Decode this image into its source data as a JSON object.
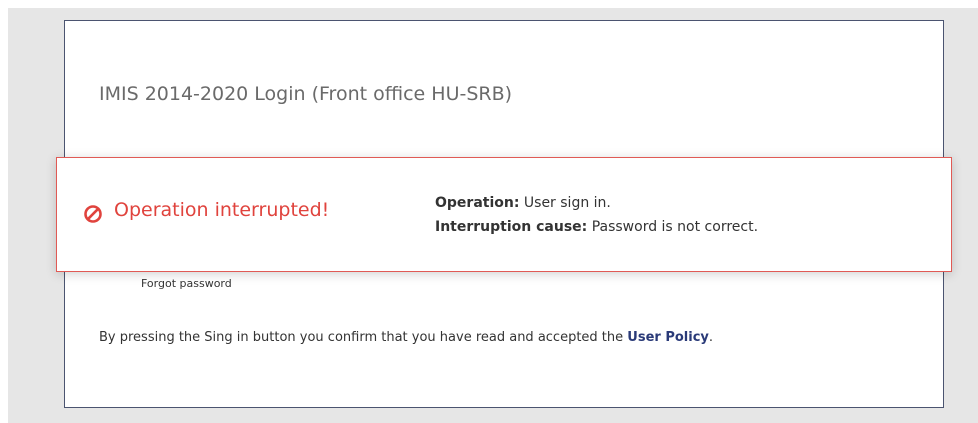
{
  "login": {
    "title": "IMIS 2014-2020 Login (Front office HU-SRB)",
    "forgot_password": "Forgot password",
    "policy_prefix": "By pressing the Sing in button you confirm that you have read and accepted the ",
    "policy_link": "User Policy",
    "policy_suffix": "."
  },
  "error": {
    "icon": "prohibited-icon",
    "heading": "Operation interrupted!",
    "operation_label": "Operation:",
    "operation_value": " User sign in.",
    "cause_label": "Interruption cause:",
    "cause_value": " Password is not correct."
  },
  "colors": {
    "error_red": "#e0433d",
    "card_border": "#4b5470",
    "policy_link": "#2a3a78",
    "backdrop": "#e6e6e6"
  }
}
